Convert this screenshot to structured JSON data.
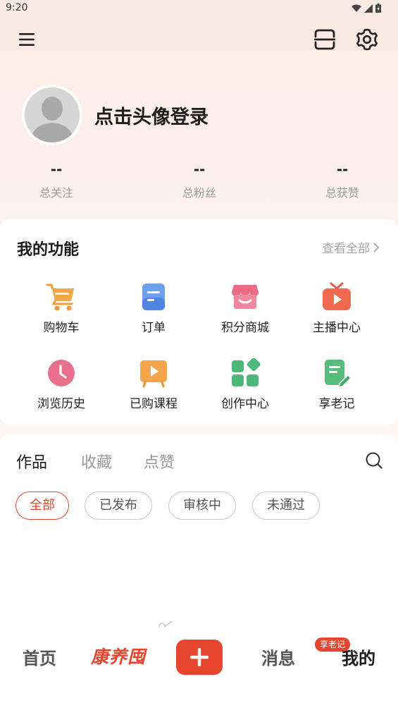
{
  "status_bar": {
    "time": "9:20"
  },
  "profile": {
    "login_prompt": "点击头像登录",
    "stats": [
      {
        "value": "--",
        "label": "总关注"
      },
      {
        "value": "--",
        "label": "总粉丝"
      },
      {
        "value": "--",
        "label": "总获赞"
      }
    ]
  },
  "functions": {
    "title": "我的功能",
    "view_all": "查看全部",
    "items": [
      {
        "label": "购物车",
        "icon": "shopping-cart-icon"
      },
      {
        "label": "订单",
        "icon": "order-icon"
      },
      {
        "label": "积分商城",
        "icon": "points-mall-icon"
      },
      {
        "label": "主播中心",
        "icon": "live-tv-icon"
      },
      {
        "label": "浏览历史",
        "icon": "clock-icon"
      },
      {
        "label": "已购课程",
        "icon": "play-course-icon"
      },
      {
        "label": "创作中心",
        "icon": "grid-apps-icon"
      },
      {
        "label": "享老记",
        "icon": "note-edit-icon"
      }
    ]
  },
  "works": {
    "tabs": [
      "作品",
      "收藏",
      "点赞"
    ],
    "filters": [
      "全部",
      "已发布",
      "审核中",
      "未通过"
    ]
  },
  "bottom_nav": {
    "home": "首页",
    "brand": "康养囤",
    "messages": "消息",
    "badge": "享老记",
    "mine": "我的"
  },
  "colors": {
    "accent": "#e8452e",
    "brand_red": "#e8452e",
    "brand_dark": "#1b1b1b"
  }
}
